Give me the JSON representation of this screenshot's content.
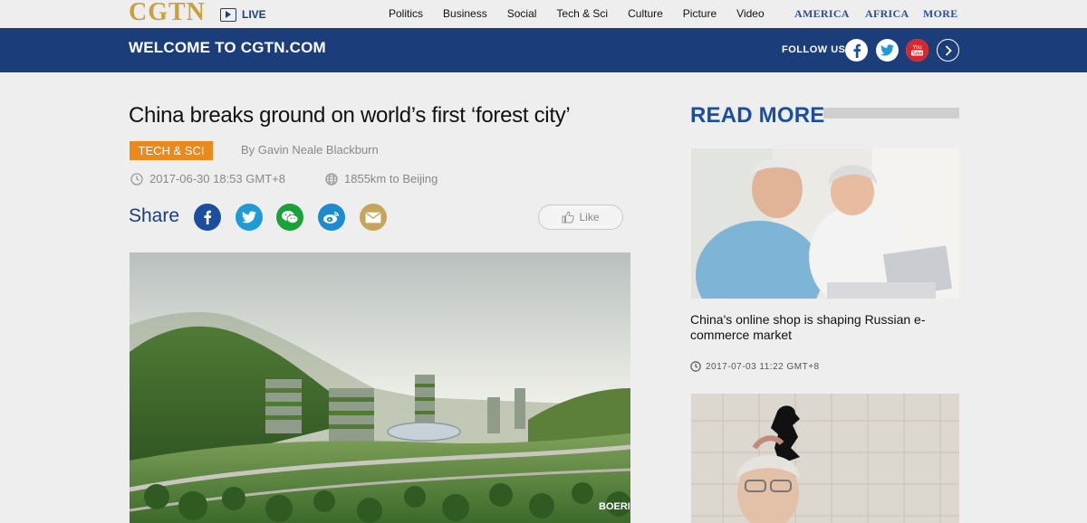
{
  "header": {
    "logo": "CGTN",
    "live_label": "LIVE",
    "nav": [
      "Politics",
      "Business",
      "Social",
      "Tech & Sci",
      "Culture",
      "Picture",
      "Video"
    ],
    "regions": [
      "AMERICA",
      "AFRICA",
      "MORE"
    ]
  },
  "banner": {
    "welcome": "WELCOME TO CGTN.COM",
    "follow_label": "FOLLOW US",
    "social_icons": [
      "facebook-icon",
      "twitter-icon",
      "youtube-icon",
      "chevron-right-icon"
    ]
  },
  "article": {
    "title": "China breaks ground on world’s first ‘forest city’",
    "category": "TECH & SCI",
    "byline": "By Gavin Neale Blackburn",
    "datetime": "2017-06-30 18:53 GMT+8",
    "distance": "1855km to Beijing",
    "share_label": "Share",
    "share_icons": [
      "facebook-icon",
      "twitter-icon",
      "wechat-icon",
      "weibo-icon",
      "mail-icon"
    ],
    "like_label": "Like",
    "image_watermark": "BOERI"
  },
  "sidebar": {
    "heading": "READ MORE",
    "items": [
      {
        "title": "China's online shop is shaping Russian e-commerce market",
        "datetime": "2017-07-03 11:22 GMT+8"
      }
    ]
  },
  "colors": {
    "brand_gold": "#c9a23e",
    "brand_blue": "#1b3e7b",
    "accent_orange": "#e98a1a",
    "link_blue": "#1b4f9e"
  }
}
